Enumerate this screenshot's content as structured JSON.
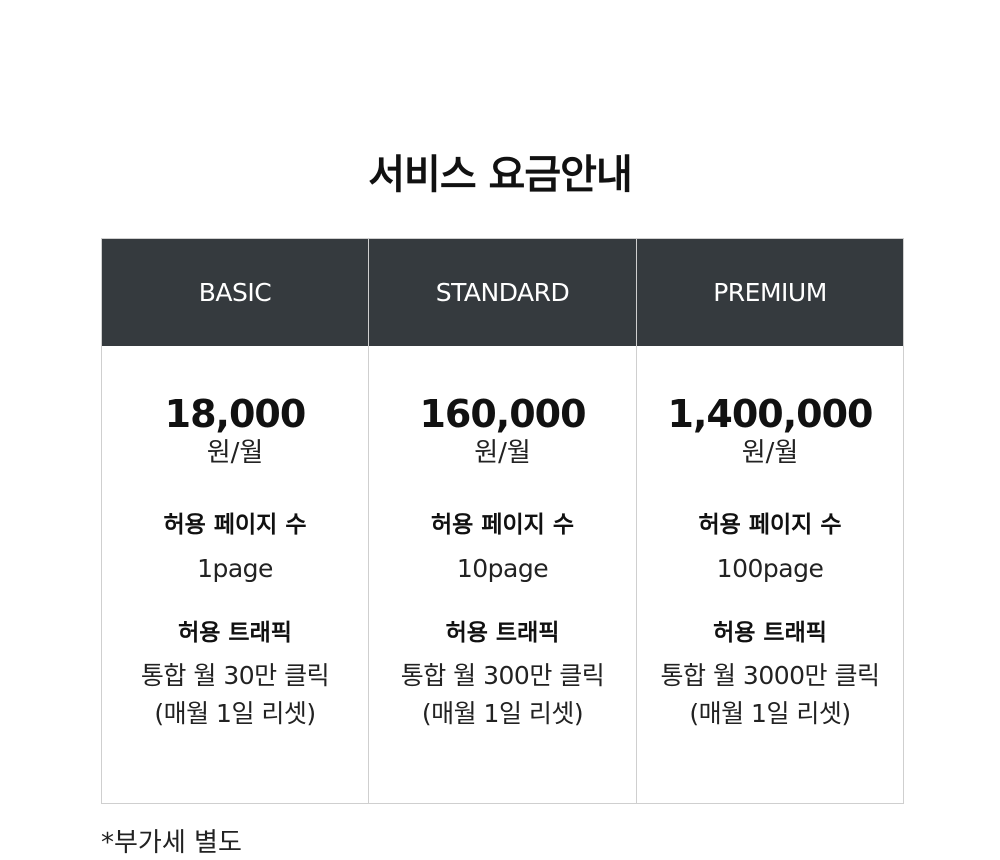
{
  "title": "서비스 요금안내",
  "plans": [
    {
      "name": "BASIC",
      "price": "18,000",
      "unit": "원/월",
      "pages_label": "허용 페이지 수",
      "pages_value": "1page",
      "traffic_label": "허용 트래픽",
      "traffic_value": "통합 월 30만 클릭",
      "traffic_note": "(매월 1일 리셋)"
    },
    {
      "name": "STANDARD",
      "price": "160,000",
      "unit": "원/월",
      "pages_label": "허용 페이지 수",
      "pages_value": "10page",
      "traffic_label": "허용 트래픽",
      "traffic_value": "통합 월 300만 클릭",
      "traffic_note": "(매월 1일 리셋)"
    },
    {
      "name": "PREMIUM",
      "price": "1,400,000",
      "unit": "원/월",
      "pages_label": "허용 페이지 수",
      "pages_value": "100page",
      "traffic_label": "허용 트래픽",
      "traffic_value": "통합 월 3000만 클릭",
      "traffic_note": "(매월 1일 리셋)"
    }
  ],
  "footnote": "*부가세 별도",
  "colors": {
    "header_bg": "#353a3e",
    "header_text": "#ffffff",
    "border": "#cfcfcf"
  }
}
